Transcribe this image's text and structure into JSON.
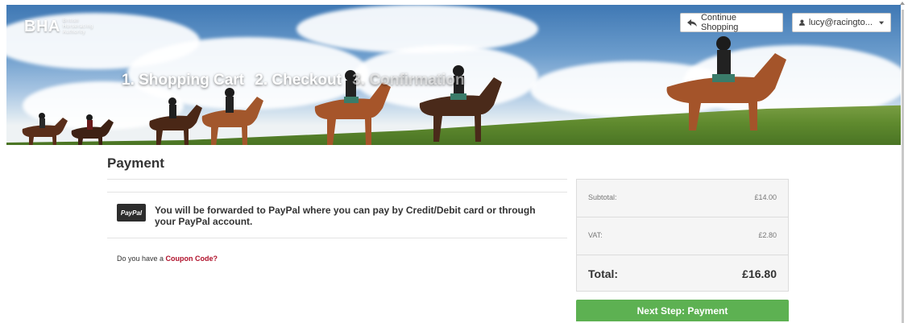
{
  "header": {
    "logo_text": "BHA",
    "logo_subtext": "British Horseracing Authority",
    "steps": [
      "1. Shopping Cart",
      "2. Checkout",
      "3. Confirmation"
    ],
    "continue_label": "Continue Shopping",
    "user_label": "lucy@racingto..."
  },
  "payment": {
    "title": "Payment",
    "paypal_logo": "PayPal",
    "paypal_message": "You will be forwarded to PayPal where you can pay by Credit/Debit card or through your PayPal account.",
    "coupon_prefix": "Do you have a ",
    "coupon_link": "Coupon Code?"
  },
  "summary": {
    "subtotal_label": "Subtotal:",
    "subtotal_value": "£14.00",
    "vat_label": "VAT:",
    "vat_value": "£2.80",
    "total_label": "Total:",
    "total_value": "£16.80"
  },
  "next_button": "Next Step: Payment",
  "colors": {
    "accent_green": "#5db152",
    "link_red": "#b0102a"
  }
}
